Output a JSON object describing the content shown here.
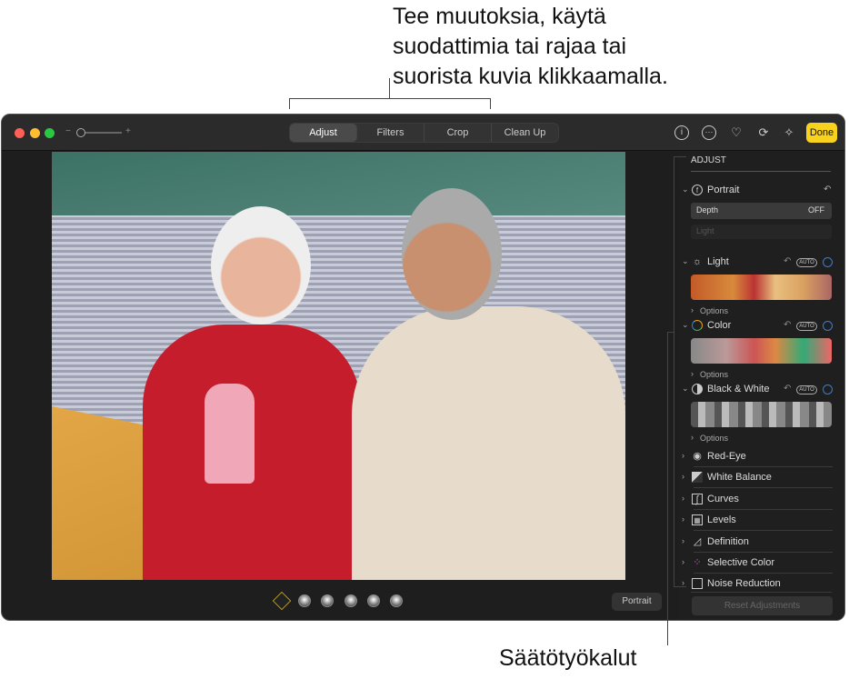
{
  "callouts": {
    "top": [
      "Tee muutoksia, käytä",
      "suodattimia tai rajaa tai",
      "suorista kuvia klikkaamalla."
    ],
    "bottom": "Säätötyökalut"
  },
  "toolbar": {
    "tabs": [
      "Adjust",
      "Filters",
      "Crop",
      "Clean Up"
    ],
    "active_tab": "Adjust",
    "zoom_minus": "−",
    "zoom_plus": "+",
    "done": "Done",
    "icons": [
      "info-icon",
      "more-icon",
      "heart-icon",
      "rotate-icon",
      "magic-wand-icon"
    ],
    "accent": "#f8d21c"
  },
  "sidebar": {
    "title": "ADJUST",
    "portrait": {
      "label": "Portrait",
      "depth_label": "Depth",
      "depth_value": "OFF",
      "light_placeholder": "Light"
    },
    "light": {
      "label": "Light",
      "auto": "AUTO",
      "options": "Options"
    },
    "color": {
      "label": "Color",
      "auto": "AUTO",
      "options": "Options"
    },
    "bw": {
      "label": "Black & White",
      "auto": "AUTO",
      "options": "Options"
    },
    "tools": [
      "Red-Eye",
      "White Balance",
      "Curves",
      "Levels",
      "Definition",
      "Selective Color",
      "Noise Reduction"
    ],
    "reset": "Reset Adjustments"
  },
  "bottom_bar": {
    "portrait_button": "Portrait",
    "lighting_options": 6
  }
}
